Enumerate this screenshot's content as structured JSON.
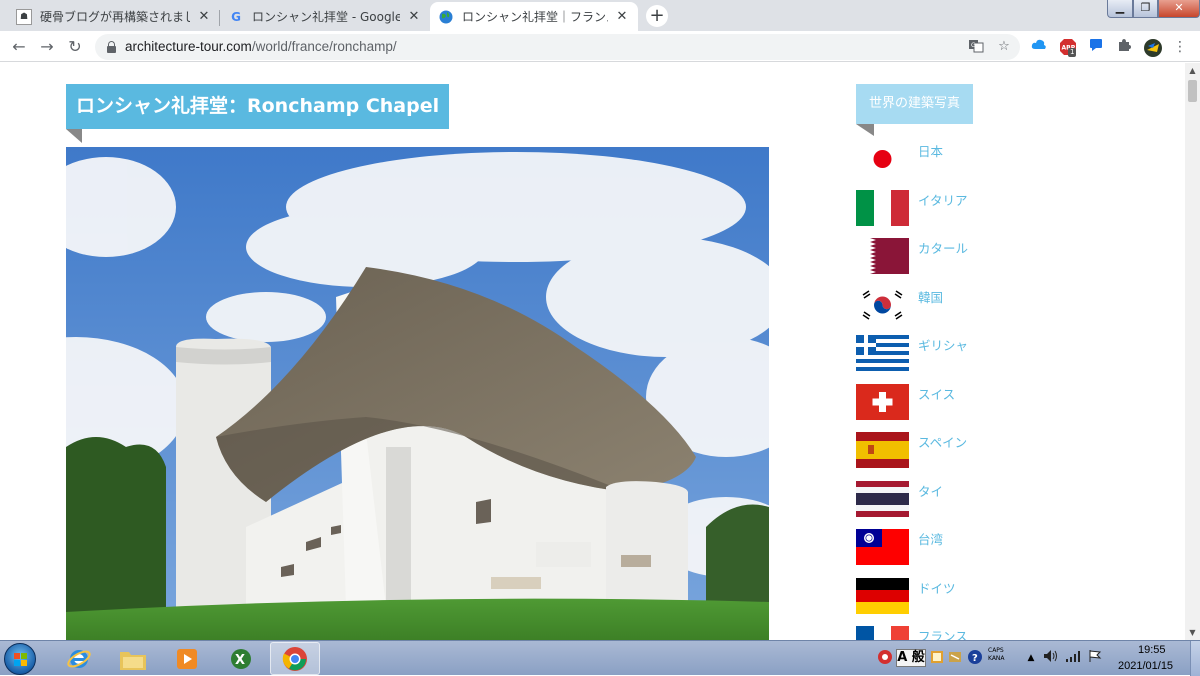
{
  "browser": {
    "tabs": [
      {
        "title": "硬骨ブログが再構築されました",
        "favicon": "blog-favicon",
        "active": false
      },
      {
        "title": "ロンシャン礼拝堂 - Google 検索",
        "favicon": "google-favicon",
        "active": false
      },
      {
        "title": "ロンシャン礼拝堂｜フランスの",
        "favicon": "globe-favicon",
        "active": true
      }
    ],
    "new_tab": "+",
    "url_host": "architecture-tour.com",
    "url_path": "/world/france/ronchamp/",
    "extensions": [
      "cloud-icon",
      "adblock-icon",
      "chat-icon",
      "puzzle-icon",
      "profile-icon",
      "menu-icon"
    ],
    "adblock_badge": "1"
  },
  "page": {
    "main_heading": "ロンシャン礼拝堂：Ronchamp Chapel",
    "sidebar_heading": "世界の建築写真",
    "countries": [
      {
        "name": "日本",
        "flag": "japan"
      },
      {
        "name": "イタリア",
        "flag": "italy"
      },
      {
        "name": "カタール",
        "flag": "qatar"
      },
      {
        "name": "韓国",
        "flag": "korea"
      },
      {
        "name": "ギリシャ",
        "flag": "greece"
      },
      {
        "name": "スイス",
        "flag": "switzerland"
      },
      {
        "name": "スペイン",
        "flag": "spain"
      },
      {
        "name": "タイ",
        "flag": "thailand"
      },
      {
        "name": "台湾",
        "flag": "taiwan"
      },
      {
        "name": "ドイツ",
        "flag": "germany"
      },
      {
        "name": "フランス",
        "flag": "france"
      }
    ]
  },
  "taskbar": {
    "apps": [
      "start-button",
      "ie-icon",
      "explorer-icon",
      "media-player-icon",
      "excel-icon",
      "chrome-icon"
    ],
    "ime_mode": "A 般",
    "caps": "CAPS",
    "kana": "KANA",
    "time": "19:55",
    "date": "2021/01/15"
  },
  "colors": {
    "heading_bg": "#5ab9e0",
    "sidebar_heading_bg": "#a7dbf2",
    "link": "#5ab9e0"
  }
}
